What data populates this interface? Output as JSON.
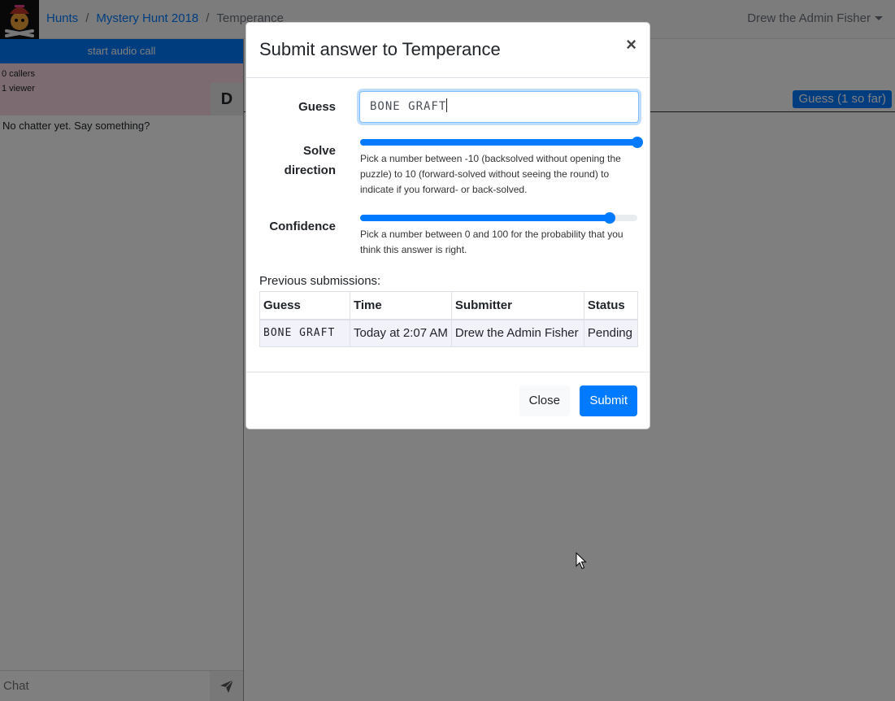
{
  "navbar": {
    "breadcrumb": [
      {
        "label": "Hunts"
      },
      {
        "label": "Mystery Hunt 2018"
      },
      {
        "label": "Temperance"
      }
    ],
    "user_name": "Drew the Admin Fisher"
  },
  "chat": {
    "audio_call_label": "start audio call",
    "callers": "0 callers",
    "viewers": "1 viewer",
    "avatar_initial": "D",
    "empty_message": "No chatter yet. Say something?",
    "input_placeholder": "Chat"
  },
  "puzzle": {
    "guess_button_label": "Guess (1 so far)"
  },
  "modal": {
    "title": "Submit answer to Temperance",
    "close_symbol": "×",
    "guess_label": "Guess",
    "guess_value": "BONE GRAFT",
    "solve_direction_label": "Solve direction",
    "solve_direction_value": 10,
    "solve_direction_range": [
      -10,
      10
    ],
    "solve_direction_help": "Pick a number between -10 (backsolved without opening the puzzle) to 10 (forward-solved without seeing the round) to indicate if you forward- or back-solved.",
    "confidence_label": "Confidence",
    "confidence_value": 90,
    "confidence_range": [
      0,
      100
    ],
    "confidence_help": "Pick a number between 0 and 100 for the probability that you think this answer is right.",
    "previous_label": "Previous submissions:",
    "table": {
      "headers": [
        "Guess",
        "Time",
        "Submitter",
        "Status"
      ],
      "rows": [
        [
          "BONE GRAFT",
          "Today at 2:07 AM",
          "Drew the Admin Fisher",
          "Pending"
        ]
      ]
    },
    "close_button": "Close",
    "submit_button": "Submit"
  },
  "colors": {
    "primary": "#007bff",
    "call_status_bg": "#f8d7e0",
    "backdrop": "rgba(0,0,0,0.5)"
  }
}
